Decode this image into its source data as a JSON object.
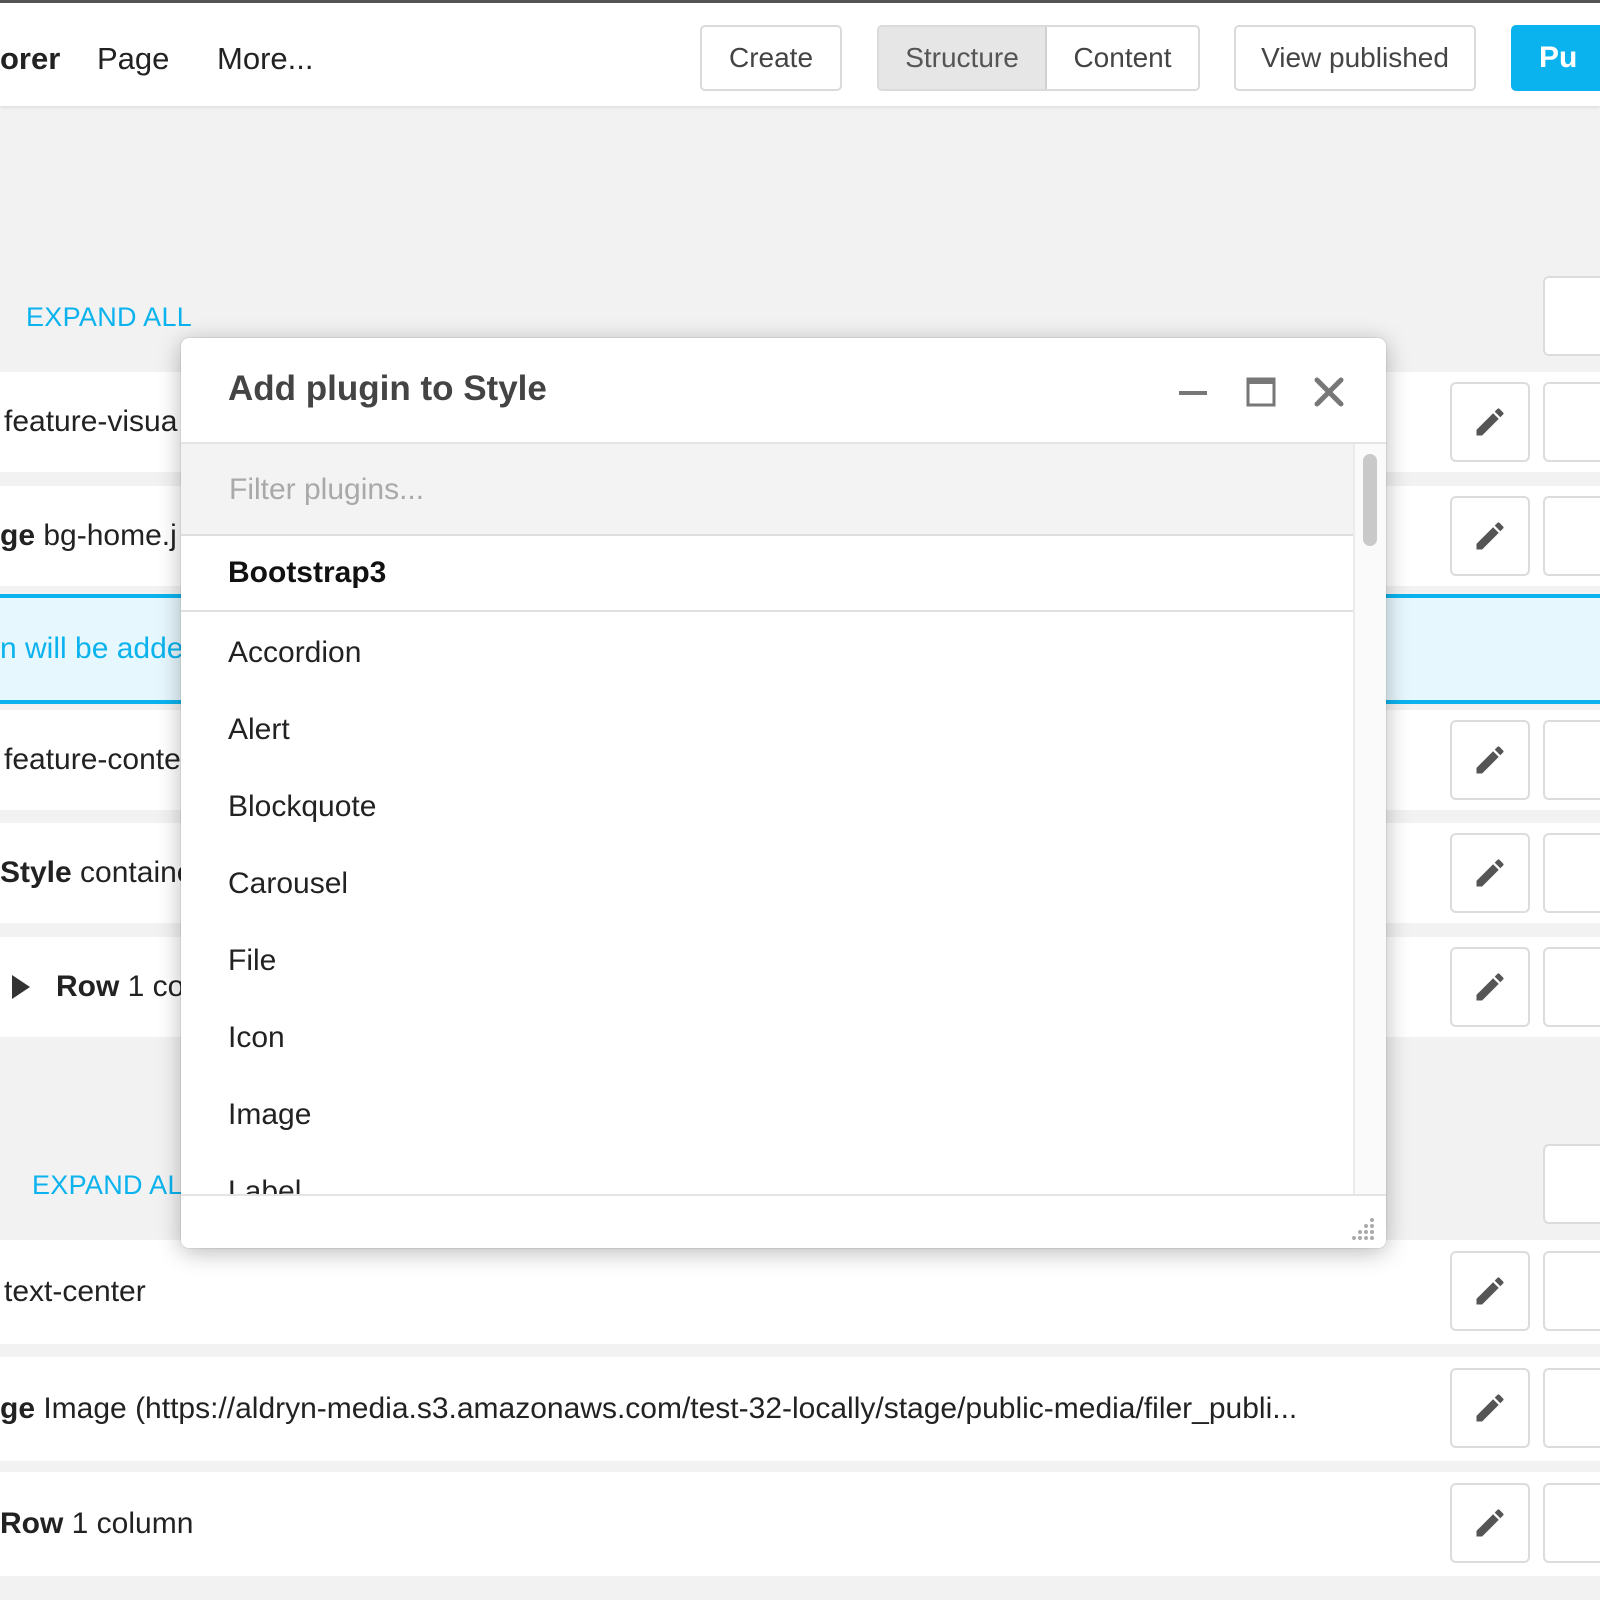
{
  "toolbar": {
    "menu": [
      "orer",
      "Page",
      "More..."
    ],
    "create_label": "Create",
    "view_toggle": {
      "structure_label": "Structure",
      "content_label": "Content",
      "active": "Structure"
    },
    "view_published_label": "View published",
    "publish_label": "Pu"
  },
  "structure": {
    "expand_all_top": "EXPAND ALL",
    "expand_all_bottom": "EXPAND AL",
    "rows_top": [
      {
        "bold": "",
        "text": "feature-visua"
      },
      {
        "bold": "ge",
        "text": " bg-home.j"
      },
      {
        "bold": "",
        "text": "n will be adde"
      },
      {
        "bold": "",
        "text": "feature-conte"
      },
      {
        "bold": "Style",
        "text": " containe"
      },
      {
        "bold": "Row",
        "text": " 1 co"
      }
    ],
    "rows_bottom": [
      {
        "bold": "",
        "text": "text-center"
      },
      {
        "bold": "ge",
        "text": " Image (https://aldryn-media.s3.amazonaws.com/test-32-locally/stage/public-media/filer_publi..."
      },
      {
        "bold": "Row",
        "text": " 1 column"
      }
    ]
  },
  "modal": {
    "title": "Add plugin to Style",
    "filter_placeholder": "Filter plugins...",
    "filter_value": "",
    "section": "Bootstrap3",
    "plugins": [
      "Accordion",
      "Alert",
      "Blockquote",
      "Carousel",
      "File",
      "Icon",
      "Image",
      "Label"
    ]
  },
  "icons": {
    "minimize": "minimize-icon",
    "maximize": "maximize-icon",
    "close": "close-icon",
    "edit": "pencil-icon",
    "expand": "triangle-right-icon",
    "resize": "resize-grip-icon"
  },
  "colors": {
    "accent": "#0bb3ee",
    "background": "#f2f2f2"
  }
}
